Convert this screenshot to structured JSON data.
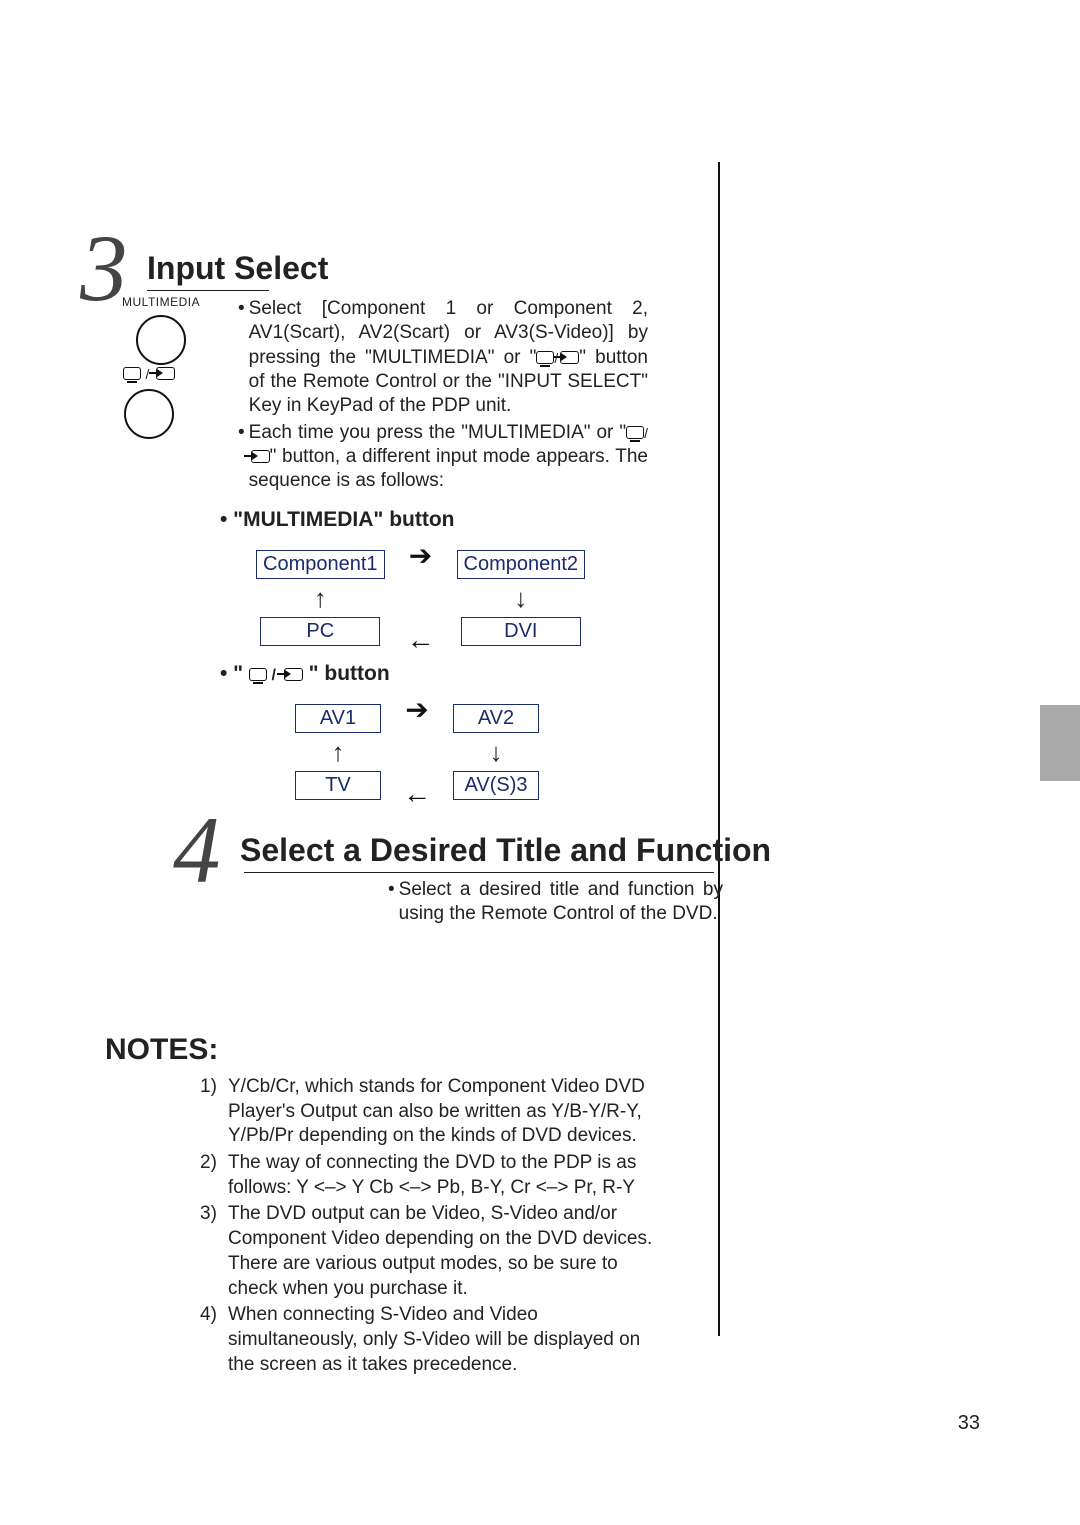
{
  "page_number": "33",
  "step3": {
    "number": "3",
    "title": "Input Select",
    "remote_label": "MULTIMEDIA",
    "p1_a": "Select [Component 1 or Component 2, AV1(Scart), AV2(Scart) or AV3(S-Video)] by pressing the \"MULTIMEDIA\" or \"",
    "p1_b": "\" button of the Remote Control or the \"INPUT SELECT\" Key in KeyPad of the PDP unit.",
    "p2_a": "Each time you press the \"MULTIMEDIA\" or \"",
    "p2_b": "\" button, a different input mode appears. The sequence is as follows:",
    "heading1": "• \"MULTIMEDIA\" button",
    "heading2_pre": "• \"",
    "heading2_post": "\" button",
    "diagram1": {
      "tl": "Component1",
      "tr": "Component2",
      "bl": "PC",
      "br": "DVI"
    },
    "diagram2": {
      "tl": "AV1",
      "tr": "AV2",
      "bl": "TV",
      "br": "AV(S)3"
    }
  },
  "step4": {
    "number": "4",
    "title": "Select a Desired Title and Function",
    "p1": "Select a desired title and function by using the Remote Control of the DVD."
  },
  "notes_title": "NOTES:",
  "notes": [
    {
      "n": "1)",
      "t": "Y/Cb/Cr, which stands for Component Video DVD Player's Output can also be written as Y/B-Y/R-Y, Y/Pb/Pr depending on the kinds of DVD devices."
    },
    {
      "n": "2)",
      "t": "The way of connecting the DVD to the PDP is as follows: Y <–> Y    Cb <–> Pb, B-Y,    Cr <–> Pr, R-Y"
    },
    {
      "n": "3)",
      "t": "The DVD output can be Video, S-Video and/or Component Video depending on the DVD devices. There are various output modes, so be sure to check when you purchase it."
    },
    {
      "n": "4)",
      "t": "When connecting S-Video and Video simultaneously, only S-Video will be displayed on the screen as it takes precedence."
    }
  ]
}
